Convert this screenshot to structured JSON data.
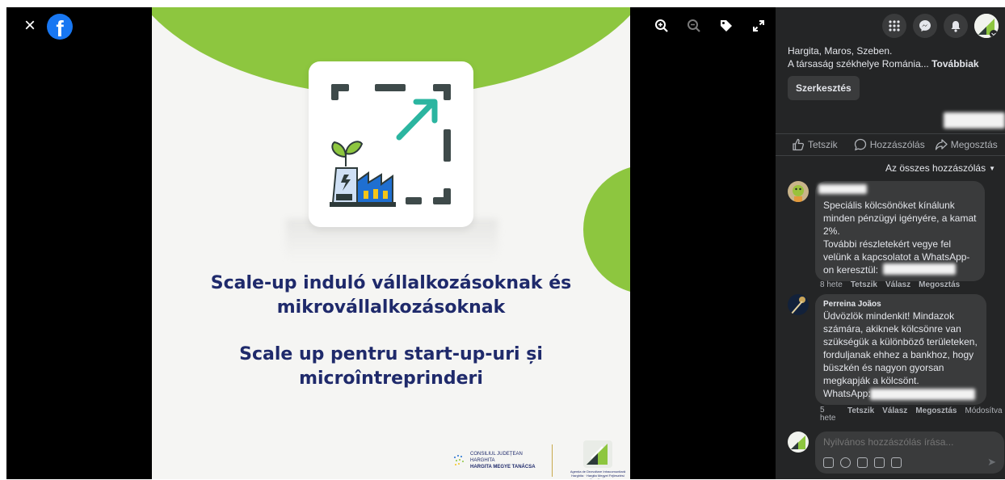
{
  "viewer": {
    "close_icon": "close-icon",
    "brand_icon": "facebook-logo",
    "brand_letter": "f",
    "tools": [
      "zoom-in-icon",
      "zoom-out-icon",
      "tag-icon",
      "fullscreen-icon"
    ]
  },
  "post_image": {
    "headline_hu_line1": "Scale-up induló vállalkozásoknak és",
    "headline_hu_line2": "mikrovállalkozásoknak",
    "headline_ro_line1": "Scale up pentru start-up-uri și",
    "headline_ro_line2": "microîntreprinderi",
    "logo_council_line1": "CONSILIUL JUDEȚEAN HARGHITA",
    "logo_council_line2": "HARGITA MEGYE TANÁCSA",
    "logo_agency_caption": "Agenția de Dezvoltare Intracomunitară Harghita · Hargita Megyei Fejlesztési Ügynökség",
    "colors": {
      "green": "#8dc63f",
      "navy": "#1f2a6b",
      "background": "#f5f5f3"
    }
  },
  "sidebar": {
    "top_icons": [
      "menu-grid-icon",
      "messenger-icon",
      "bell-icon",
      "account-avatar"
    ],
    "info_line1": "Hargita, Maros, Szeben.",
    "info_line2": "A társaság székhelye Románia...",
    "info_more": "Továbbiak",
    "edit_label": "Szerkesztés",
    "actions": {
      "like": "Tetszik",
      "comment": "Hozzászólás",
      "share": "Megosztás"
    },
    "filter_label": "Az összes hozzászólás",
    "comments": [
      {
        "name": "",
        "lines": [
          "Speciális kölcsönöket kínálunk",
          "minden pénzügyi igényére, a kamat",
          "2%.",
          "További részletekért vegye fel",
          "velünk a kapcsolatot a WhatsApp-",
          "on keresztül:"
        ],
        "time": "8 hete",
        "like": "Tetszik",
        "reply": "Válasz",
        "share": "Megosztás"
      },
      {
        "name": "Perreina Joãos",
        "lines": [
          "Üdvözlök mindenkit! Mindazok",
          "számára, akiknek kölcsönre van",
          "szükségük a különböző területeken,",
          "forduljanak ehhez a bankhoz, hogy",
          "büszkén és nagyon gyorsan",
          "megkapják a kölcsönt.",
          "WhatsApp:"
        ],
        "time_line1": "5",
        "time_line2": "hete",
        "like": "Tetszik",
        "reply": "Válasz",
        "share": "Megosztás",
        "edited": "Módosítva"
      }
    ],
    "composer_placeholder": "Nyilvános hozzászólás írása...",
    "colors": {
      "panel": "#242526",
      "bubble": "#3a3b3c",
      "text": "#e4e6eb",
      "muted": "#b0b3b8"
    }
  }
}
